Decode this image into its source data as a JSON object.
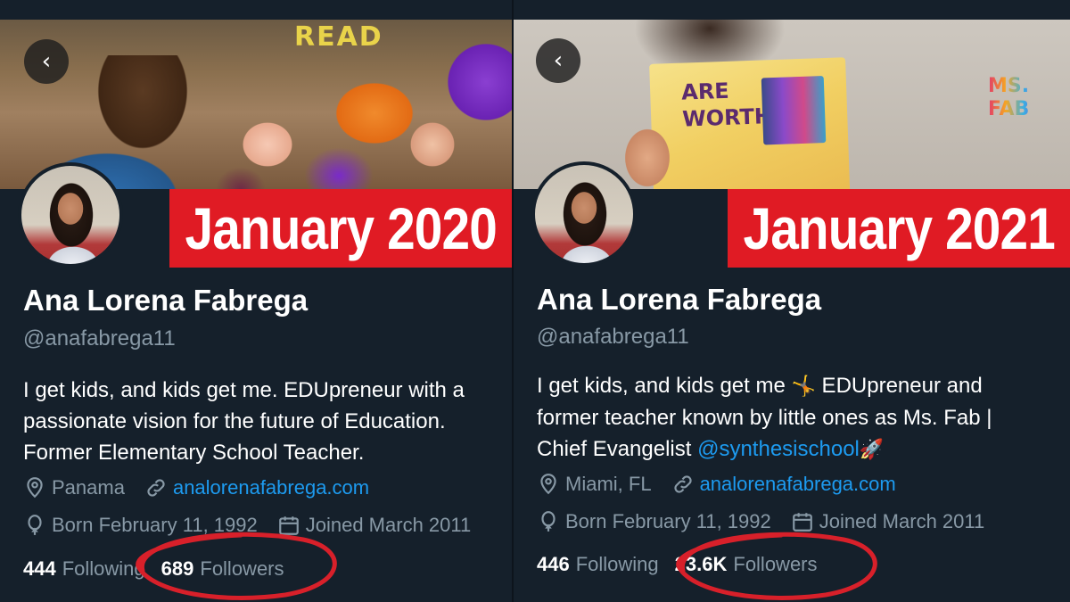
{
  "panels": [
    {
      "date_label": "January 2020",
      "name": "Ana Lorena Fabrega",
      "handle": "@anafabrega11",
      "bio_lines": [
        "I get kids, and kids get me. EDUpreneur with a",
        "passionate vision for the future of Education.",
        "Former Elementary School Teacher."
      ],
      "location": "Panama",
      "website": "analorenafabrega.com",
      "born": "Born February 11, 1992",
      "joined": "Joined March 2011",
      "following_count": "444",
      "following_label": "Following",
      "followers_count": "689",
      "followers_label": "Followers",
      "banner_sign": "READ"
    },
    {
      "date_label": "January 2021",
      "name": "Ana Lorena Fabrega",
      "handle": "@anafabrega11",
      "bio_line1_a": "I get kids, and kids get me",
      "bio_line1_emoji": "🤸",
      "bio_line1_b": " EDUpreneur and",
      "bio_line2": "former teacher known by little ones as Ms. Fab |",
      "bio_line3_a": "Chief Evangelist ",
      "bio_line3_mention": "@synthesischool",
      "bio_line3_emoji": "🚀",
      "location": "Miami, FL",
      "website": "analorenafabrega.com",
      "born": "Born February 11, 1992",
      "joined": "Joined March 2011",
      "following_count": "446",
      "following_label": "Following",
      "followers_count": "23.6K",
      "followers_label": "Followers",
      "book_title_1": "ARE",
      "book_title_2": "WORTH",
      "brand_logo_1": "MS.",
      "brand_logo_2": "FAB"
    }
  ],
  "icons": {
    "back": "chevron-left-icon",
    "location": "map-pin-icon",
    "link": "link-icon",
    "born": "balloon-icon",
    "joined": "calendar-icon"
  },
  "colors": {
    "background": "#15202b",
    "accent_link": "#1d9bf0",
    "secondary_text": "#8899a6",
    "badge_red": "#e01b24",
    "circle_red": "#d8202a"
  }
}
